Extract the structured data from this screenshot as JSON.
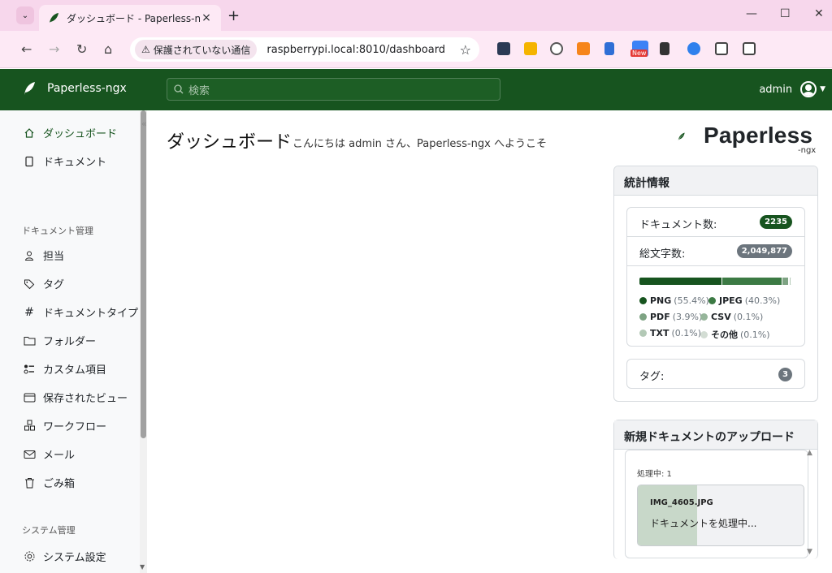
{
  "browser": {
    "tab_title": "ダッシュボード - Paperless-ngx",
    "tab_close": "×",
    "new_tab": "+",
    "security_label": "保護されていない通信",
    "url": "raspberrypi.local:8010/dashboard",
    "ext_new_badge": "New"
  },
  "navbar": {
    "brand": "Paperless-ngx",
    "search_placeholder": "検索",
    "user": "admin"
  },
  "sidebar": {
    "items_top": [
      {
        "label": "ダッシュボード",
        "icon": "house-icon"
      },
      {
        "label": "ドキュメント",
        "icon": "file-icon"
      }
    ],
    "heading_docs": "ドキュメント管理",
    "items_docs": [
      {
        "label": "担当",
        "icon": "person-icon"
      },
      {
        "label": "タグ",
        "icon": "tags-icon"
      },
      {
        "label": "ドキュメントタイプ",
        "icon": "hash-icon"
      },
      {
        "label": "フォルダー",
        "icon": "folder-icon"
      },
      {
        "label": "カスタム項目",
        "icon": "ui-radios-icon"
      },
      {
        "label": "保存されたビュー",
        "icon": "window-stack-icon"
      },
      {
        "label": "ワークフロー",
        "icon": "boxes-icon"
      },
      {
        "label": "メール",
        "icon": "envelope-icon"
      },
      {
        "label": "ごみ箱",
        "icon": "trash-icon"
      }
    ],
    "heading_system": "システム管理",
    "items_system": [
      {
        "label": "システム設定",
        "icon": "gear-icon"
      }
    ]
  },
  "main": {
    "title": "ダッシュボード",
    "subtitle": "こんにちは admin さん、Paperless-ngx へようこそ",
    "logo_word": "Paperless",
    "logo_sub": "-ngx"
  },
  "stats": {
    "title": "統計情報",
    "doc_count_label": "ドキュメント数:",
    "doc_count": "2235",
    "chars_label": "総文字数:",
    "chars": "2,049,877",
    "tags_label": "タグ:",
    "tags": "3",
    "filetypes": [
      {
        "name": "PNG",
        "pct_text": "(55.4%)",
        "pct": 55.4,
        "color": "#17541f"
      },
      {
        "name": "JPEG",
        "pct_text": "(40.3%)",
        "pct": 40.3,
        "color": "#3c7a44"
      },
      {
        "name": "PDF",
        "pct_text": "(3.9%)",
        "pct": 3.9,
        "color": "#7ea383"
      },
      {
        "name": "CSV",
        "pct_text": "(0.1%)",
        "pct": 0.1,
        "color": "#96b59a"
      },
      {
        "name": "TXT",
        "pct_text": "(0.1%)",
        "pct": 0.1,
        "color": "#b3c9b6"
      },
      {
        "name": "その他",
        "pct_text": "(0.1%)",
        "pct": 0.1,
        "color": "#d3ddd4"
      }
    ]
  },
  "upload": {
    "title": "新規ドキュメントのアップロード",
    "processing": "処理中: 1",
    "file_name": "IMG_4605.JPG",
    "file_status": "ドキュメントを処理中...",
    "progress": 0.36
  },
  "colors": {
    "primary": "#17541f",
    "tab_bg": "#f7d7ec",
    "badge_dark": "#17541f",
    "badge_gray": "#6c757d"
  }
}
